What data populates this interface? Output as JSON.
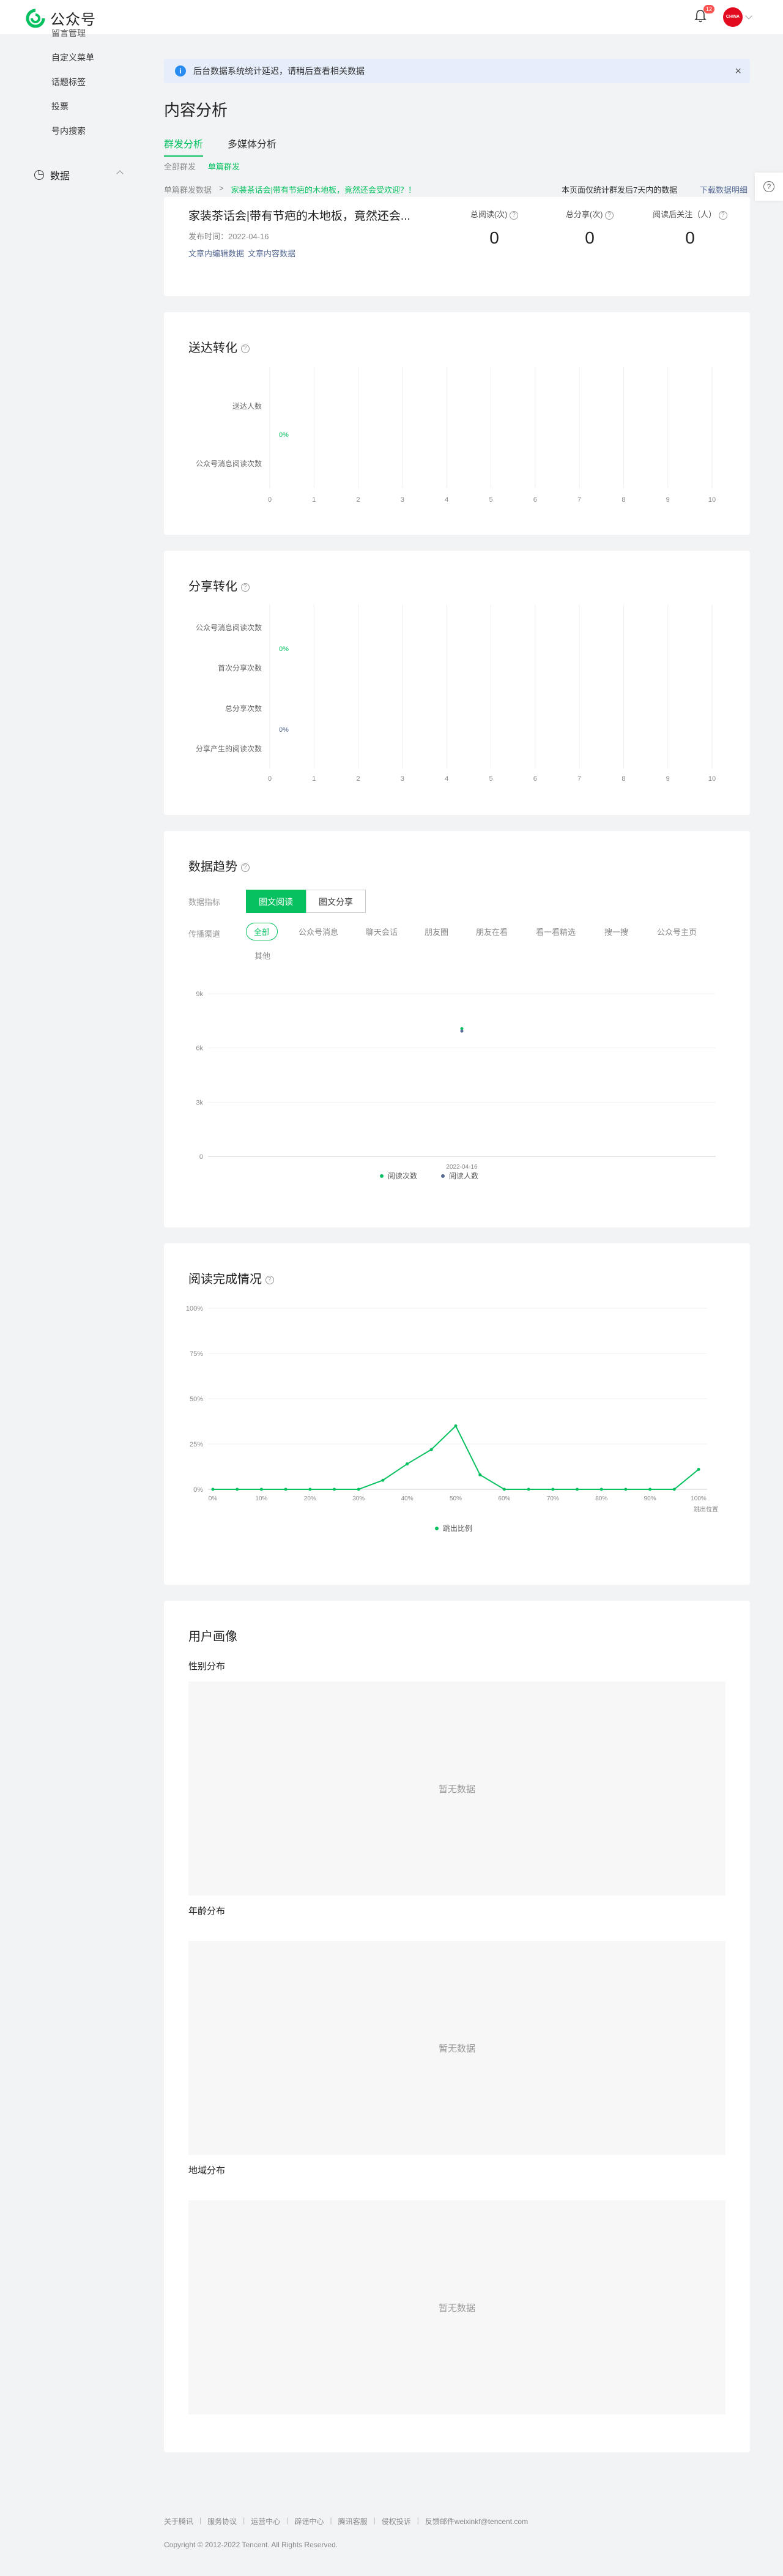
{
  "header": {
    "logo_text": "公众号",
    "notification_count": "12",
    "avatar_text": "CHINA"
  },
  "sidebar": {
    "cut_item": "留言管理",
    "items": [
      "自定义菜单",
      "话题标签",
      "投票",
      "号内搜索"
    ],
    "group_label": "数据"
  },
  "notice": {
    "text": "后台数据系统统计延迟，请稍后查看相关数据",
    "close": "×"
  },
  "page_title": "内容分析",
  "tabs": [
    "群发分析",
    "多媒体分析"
  ],
  "subtabs": [
    "全部群发",
    "单篇群发"
  ],
  "breadcrumb": {
    "parent": "单篇群发数据",
    "sep": ">",
    "current": "家装茶话会|带有节疤的木地板，竟然还会受欢迎？！"
  },
  "range_note": "本页面仅统计群发后7天内的数据",
  "download_label": "下载数据明细",
  "help_icon": "?",
  "article": {
    "title": "家装茶话会|带有节疤的木地板，竟然还会...",
    "date_label": "发布时间：2022-04-16",
    "links": [
      "文章内编辑数据",
      "文章内容数据"
    ],
    "metrics": [
      {
        "label": "总阅读(次)",
        "value": "0"
      },
      {
        "label": "总分享(次)",
        "value": "0"
      },
      {
        "label": "阅读后关注（人）",
        "value": "0"
      }
    ]
  },
  "delivery": {
    "title": "送达转化",
    "rows": [
      "送达人数",
      "公众号消息阅读次数"
    ],
    "pct": "0%",
    "ticks": [
      "0",
      "1",
      "2",
      "3",
      "4",
      "5",
      "6",
      "7",
      "8",
      "9",
      "10"
    ]
  },
  "share": {
    "title": "分享转化",
    "rows": [
      "公众号消息阅读次数",
      "首次分享次数",
      "总分享次数",
      "分享产生的阅读次数"
    ],
    "pct1": "0%",
    "pct2": "0%",
    "ticks": [
      "0",
      "1",
      "2",
      "3",
      "4",
      "5",
      "6",
      "7",
      "8",
      "9",
      "10"
    ]
  },
  "trend": {
    "title": "数据趋势",
    "metric_label": "数据指标",
    "buttons": [
      "图文阅读",
      "图文分享"
    ],
    "channel_label": "传播渠道",
    "chips": [
      "全部",
      "公众号消息",
      "聊天会话",
      "朋友圈",
      "朋友在看",
      "看一看精选",
      "搜一搜",
      "公众号主页",
      "其他"
    ]
  },
  "completion": {
    "title": "阅读完成情况",
    "xaxis_name": "跳出位置"
  },
  "portrait": {
    "title": "用户画像",
    "sections": [
      "性别分布",
      "年龄分布",
      "地域分布"
    ],
    "empty": "暂无数据"
  },
  "footer": {
    "links": [
      "关于腾讯",
      "服务协议",
      "运营中心",
      "辟谣中心",
      "腾讯客服",
      "侵权投诉",
      "反馈邮件weixinkf@tencent.com"
    ],
    "copyright": "Copyright © 2012-2022 Tencent. All Rights Reserved."
  },
  "colors": {
    "accent": "#07c160",
    "link": "#576b95",
    "notice_bg": "#e6eefb"
  },
  "chart_data": [
    {
      "type": "line",
      "title": "数据趋势",
      "categories": [
        "2022-04-16"
      ],
      "series": [
        {
          "name": "阅读次数",
          "values": [
            7000
          ]
        },
        {
          "name": "阅读人数",
          "values": [
            7000
          ]
        }
      ],
      "yticks": [
        "0",
        "3k",
        "6k",
        "9k"
      ],
      "ylim": [
        0,
        9000
      ],
      "legend": "bottom"
    },
    {
      "type": "line",
      "title": "阅读完成情况",
      "xlabel": "跳出位置",
      "xticks": [
        "0%",
        "10%",
        "20%",
        "30%",
        "40%",
        "50%",
        "60%",
        "70%",
        "80%",
        "90%",
        "100%"
      ],
      "yticks": [
        "0%",
        "25%",
        "50%",
        "75%",
        "100%"
      ],
      "ylim": [
        0,
        100
      ],
      "series": [
        {
          "name": "跳出比例",
          "x": [
            0,
            5,
            10,
            15,
            20,
            25,
            30,
            35,
            40,
            45,
            50,
            55,
            60,
            65,
            70,
            75,
            80,
            85,
            90,
            95,
            100
          ],
          "values": [
            0,
            0,
            0,
            0,
            0,
            0,
            0,
            5,
            14,
            22,
            35,
            8,
            0,
            0,
            0,
            0,
            0,
            0,
            0,
            0,
            11
          ]
        }
      ],
      "legend": "bottom"
    }
  ]
}
